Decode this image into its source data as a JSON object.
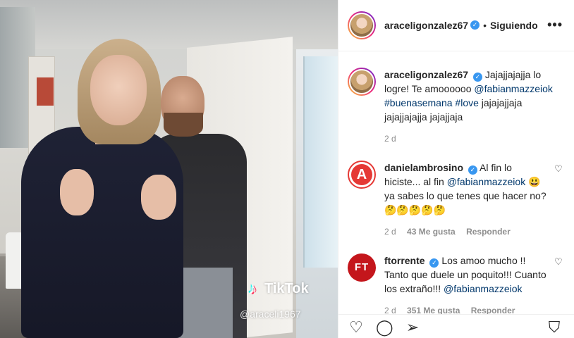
{
  "media": {
    "watermark_brand": "TikTok",
    "watermark_user": "@araceli1967"
  },
  "header": {
    "username": "araceligonzalez67",
    "separator": "•",
    "follow_state": "Siguiendo",
    "more": "•••"
  },
  "caption": {
    "username": "araceligonzalez67",
    "text_1": "Jajajjajajja lo logre! Te amoooooo",
    "mention": "@fabianmazzeiok",
    "hashtag_1": "#buenasemana",
    "hashtag_2": "#love",
    "text_2": "jajajajjaja jajajjajajja jajajjaja",
    "time": "2 d"
  },
  "comments": [
    {
      "username": "danielambrosino",
      "text_1": "Al fin lo hiciste... al fin",
      "mention": "@fabianmazzeiok",
      "text_2": "😃ya sabes lo que tenes que hacer no?🤔🤔🤔🤔🤔",
      "time": "2 d",
      "likes": "43 Me gusta",
      "reply": "Responder"
    },
    {
      "username": "ftorrente",
      "avatar_text": "FT",
      "text_1": "Los amoo mucho !! Tanto que duele un poquito!!! Cuanto los extraño!!!",
      "mention": "@fabianmazzeiok",
      "time": "2 d",
      "likes": "351 Me gusta",
      "reply": "Responder"
    }
  ],
  "icons": {
    "verified": "✓",
    "heart": "♡",
    "like": "♡",
    "comment": "◯",
    "share": "➢",
    "save": "⛉",
    "marvel": "A"
  },
  "colors": {
    "link": "#00376b",
    "verified": "#3897f0",
    "meta": "#8e8e8e"
  }
}
